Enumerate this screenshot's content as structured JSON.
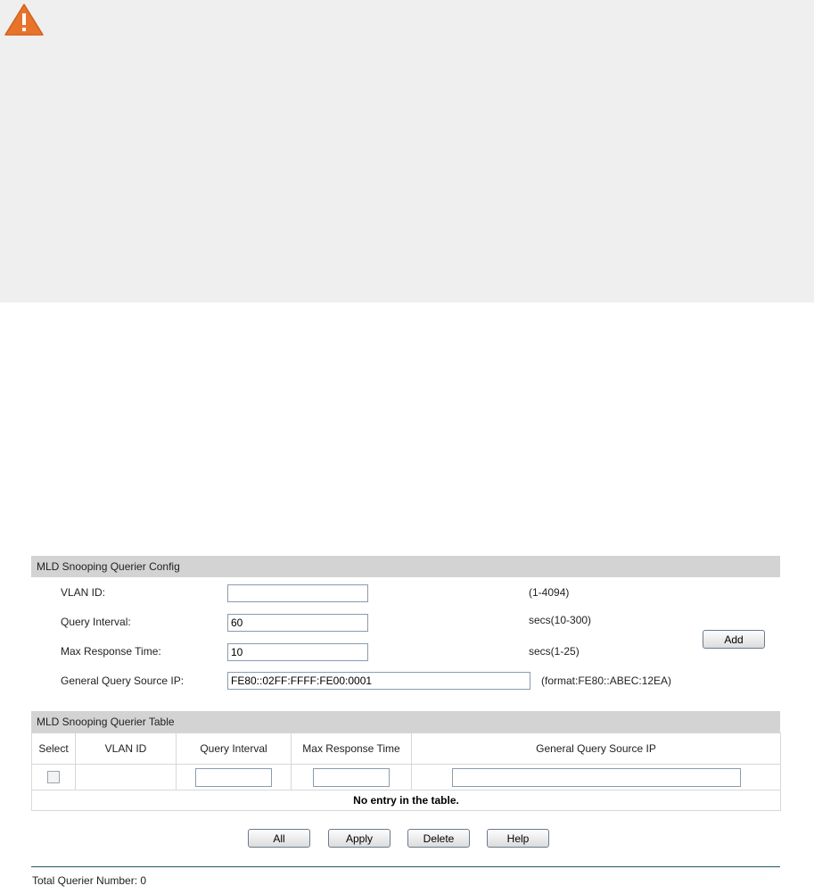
{
  "notice": {
    "icon": "warning-triangle-icon",
    "icon_color": "#e8732a"
  },
  "config": {
    "title": "MLD Snooping Querier Config",
    "fields": [
      {
        "label": "VLAN ID:",
        "value": "",
        "hint": "(1-4094)"
      },
      {
        "label": "Query Interval:",
        "value": "60",
        "hint": "secs(10-300)"
      },
      {
        "label": "Max Response Time:",
        "value": "10",
        "hint": "secs(1-25)"
      },
      {
        "label": "General Query Source IP:",
        "value": "FE80::02FF:FFFF:FE00:0001",
        "hint": "(format:FE80::ABEC:12EA)"
      }
    ],
    "add_label": "Add"
  },
  "table": {
    "title": "MLD Snooping Querier Table",
    "columns": [
      "Select",
      "VLAN ID",
      "Query Interval",
      "Max Response Time",
      "General Query Source IP"
    ],
    "empty_message": "No entry in the table."
  },
  "actions": {
    "all": "All",
    "apply": "Apply",
    "delete": "Delete",
    "help": "Help"
  },
  "footer": {
    "total_label": "Total Querier Number: 0"
  }
}
